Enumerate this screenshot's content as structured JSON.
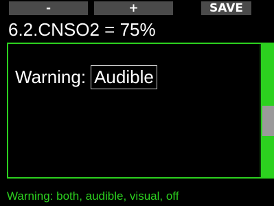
{
  "softkeys": {
    "minus": "-",
    "plus": "+",
    "save": "SAVE"
  },
  "title": "6.2.CNSO2 = 75%",
  "setting": {
    "label": "Warning:",
    "value": "Audible"
  },
  "scroll": {
    "position_fraction": 0.6
  },
  "hint": "Warning: both, audible, visual, off",
  "colors": {
    "accent": "#2cd11f",
    "background": "#000000",
    "softkey_bg": "#4a4a4a",
    "scroll_thumb": "#9a9a9a"
  }
}
